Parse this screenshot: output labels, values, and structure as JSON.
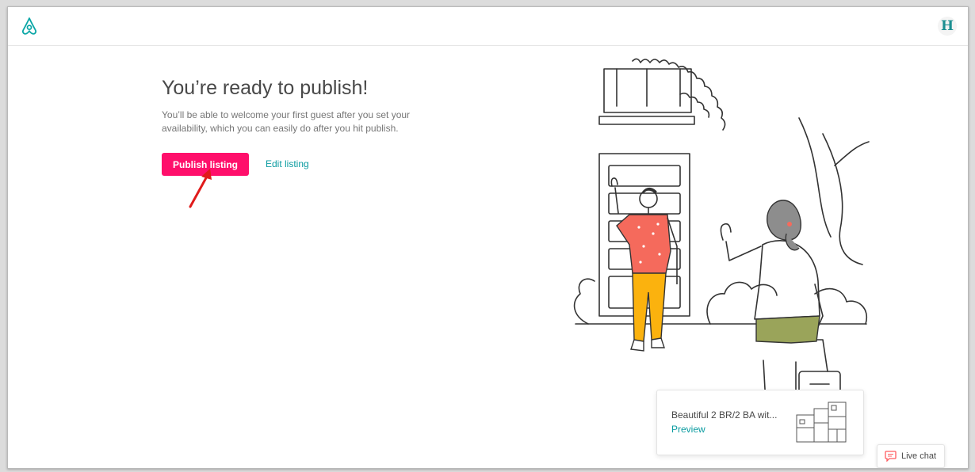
{
  "header": {
    "logo_icon": "airbnb-logo-icon",
    "avatar_letter": "H"
  },
  "main": {
    "title": "You’re ready to publish!",
    "subtitle": "You’ll be able to welcome your first guest after you set your availability, which you can easily do after you hit publish.",
    "publish_label": "Publish listing",
    "edit_label": "Edit listing"
  },
  "preview": {
    "title": "Beautiful 2 BR/2 BA wit...",
    "link_label": "Preview",
    "thumbnail_icon": "floor-plan-icon"
  },
  "chat": {
    "label": "Live chat",
    "icon": "chat-bubble-icon"
  },
  "colors": {
    "primary": "#ff0f6b",
    "link": "#0a9ba0",
    "heading": "#484848",
    "muted": "#767676"
  }
}
